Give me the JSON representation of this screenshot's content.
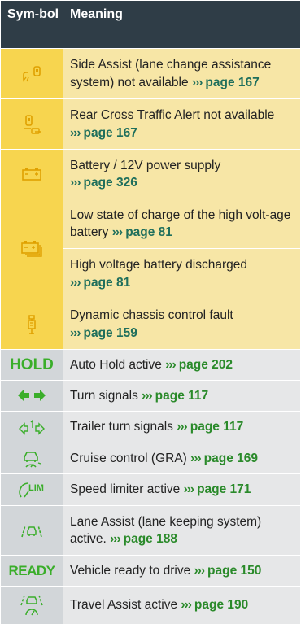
{
  "header": {
    "symbol": "Sym-bol",
    "meaning": "Meaning"
  },
  "ref_arrows": "›››",
  "rows": [
    {
      "icon": "side-assist-icon",
      "text": "Side Assist (lane change assistance system) not available",
      "ref": "page 167"
    },
    {
      "icon": "rear-cross-traffic-icon",
      "text": "Rear Cross Traffic Alert not available",
      "ref": "page 167"
    },
    {
      "icon": "battery-icon",
      "text": "Battery / 12V power supply",
      "ref": "page 326"
    },
    {
      "icon": "high-voltage-battery-icon",
      "text": "Low state of charge of the high volt-age battery",
      "ref": "page 81"
    },
    {
      "icon": "",
      "text": "High voltage battery discharged",
      "ref": "page 81"
    },
    {
      "icon": "chassis-control-icon",
      "text": "Dynamic chassis control fault",
      "ref": "page 159"
    },
    {
      "icon": "hold-icon",
      "icon_text": "HOLD",
      "text": "Auto Hold active",
      "ref": "page 202"
    },
    {
      "icon": "turn-signals-icon",
      "text": "Turn signals",
      "ref": "page 117"
    },
    {
      "icon": "trailer-turn-signals-icon",
      "text": "Trailer turn signals",
      "ref": "page 117"
    },
    {
      "icon": "cruise-control-icon",
      "text": "Cruise control (GRA)",
      "ref": "page 169"
    },
    {
      "icon": "speed-limiter-icon",
      "icon_text": "LIM",
      "text": "Speed limiter active",
      "ref": "page 171"
    },
    {
      "icon": "lane-assist-icon",
      "text": "Lane Assist (lane keeping system) active.",
      "ref": "page 188"
    },
    {
      "icon": "ready-icon",
      "icon_text": "READY",
      "text": "Vehicle ready to drive",
      "ref": "page 150"
    },
    {
      "icon": "travel-assist-icon",
      "text": "Travel Assist active",
      "ref": "page 190"
    }
  ],
  "colors": {
    "header_bg": "#2f3d47",
    "yellow_icon_bg": "#f7d54f",
    "yellow_text_bg": "#f7e6a6",
    "grey_bg": "#e6e7e8",
    "green": "#3aae2a"
  }
}
